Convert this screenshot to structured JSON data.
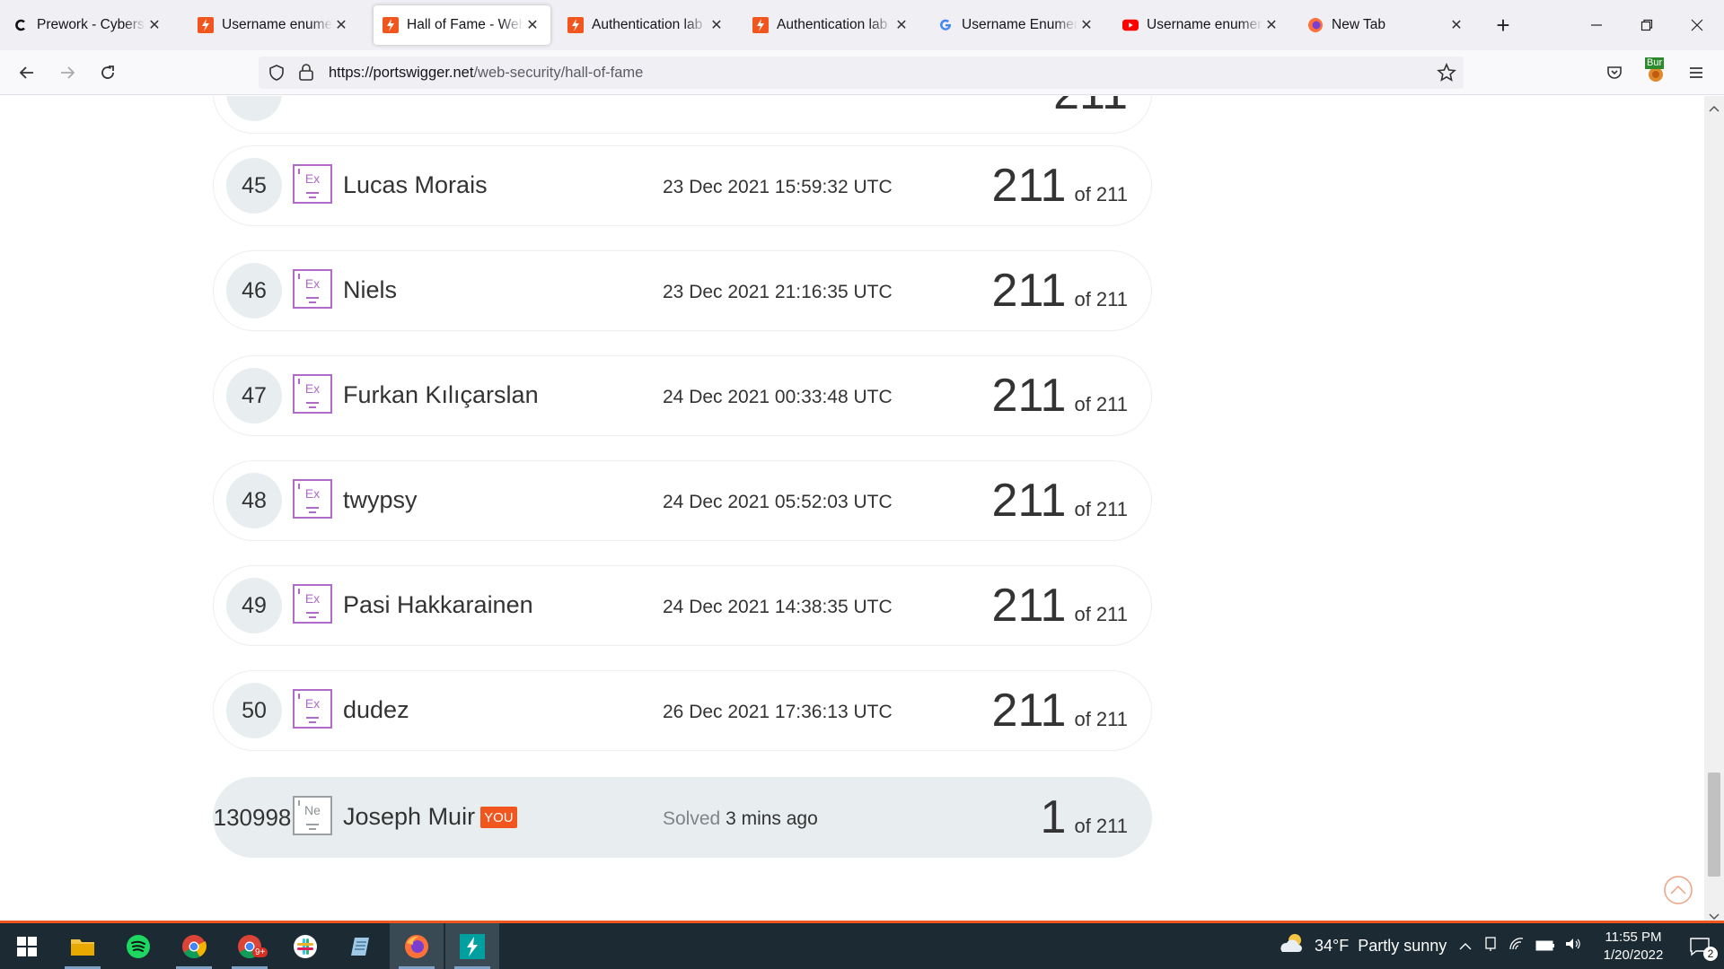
{
  "browser": {
    "tabs": [
      {
        "title": "Prework - Cybersecu",
        "icon": "c-favicon",
        "active": false
      },
      {
        "title": "Username enumerati",
        "icon": "portswigger-favicon",
        "active": false
      },
      {
        "title": "Hall of Fame - Web S",
        "icon": "portswigger-favicon",
        "active": true
      },
      {
        "title": "Authentication lab u",
        "icon": "portswigger-favicon",
        "active": false
      },
      {
        "title": "Authentication lab p",
        "icon": "portswigger-favicon",
        "active": false
      },
      {
        "title": "Username Enumerati",
        "icon": "google-favicon",
        "active": false
      },
      {
        "title": "Username enumerati",
        "icon": "youtube-favicon",
        "active": false
      },
      {
        "title": "New Tab",
        "icon": "firefox-favicon",
        "active": false
      }
    ],
    "url_host": "https://portswigger.net",
    "url_path": "/web-security/hall-of-fame",
    "extension_badge": "Bur"
  },
  "hall_of_fame": {
    "rows": [
      {
        "rank": "45",
        "badge": "Ex",
        "name": "Lucas Morais",
        "date": "23 Dec 2021 15:59:32 UTC",
        "score": "211",
        "of": "of 211"
      },
      {
        "rank": "46",
        "badge": "Ex",
        "name": "Niels",
        "date": "23 Dec 2021 21:16:35 UTC",
        "score": "211",
        "of": "of 211"
      },
      {
        "rank": "47",
        "badge": "Ex",
        "name": "Furkan Kılıçarslan",
        "date": "24 Dec 2021 00:33:48 UTC",
        "score": "211",
        "of": "of 211"
      },
      {
        "rank": "48",
        "badge": "Ex",
        "name": "twypsy",
        "date": "24 Dec 2021 05:52:03 UTC",
        "score": "211",
        "of": "of 211"
      },
      {
        "rank": "49",
        "badge": "Ex",
        "name": "Pasi Hakkarainen",
        "date": "24 Dec 2021 14:38:35 UTC",
        "score": "211",
        "of": "of 211"
      },
      {
        "rank": "50",
        "badge": "Ex",
        "name": "dudez",
        "date": "26 Dec 2021 17:36:13 UTC",
        "score": "211",
        "of": "of 211"
      }
    ],
    "partial_top_score": "211",
    "you_row": {
      "rank": "130998",
      "badge": "Ne",
      "name": "Joseph Muir",
      "tag": "YOU",
      "solved_prefix": "Solved",
      "solved_time": "3 mins ago",
      "score": "1",
      "of": "of 211"
    }
  },
  "taskbar": {
    "weather_temp": "34°F",
    "weather_text": "Partly sunny",
    "time": "11:55 PM",
    "date": "1/20/2022",
    "notification_count": "2",
    "chrome_badge": "9+"
  },
  "colors": {
    "accent": "#f0561d",
    "badge_purple": "#b06ac8",
    "row_gray": "#e8edef"
  }
}
